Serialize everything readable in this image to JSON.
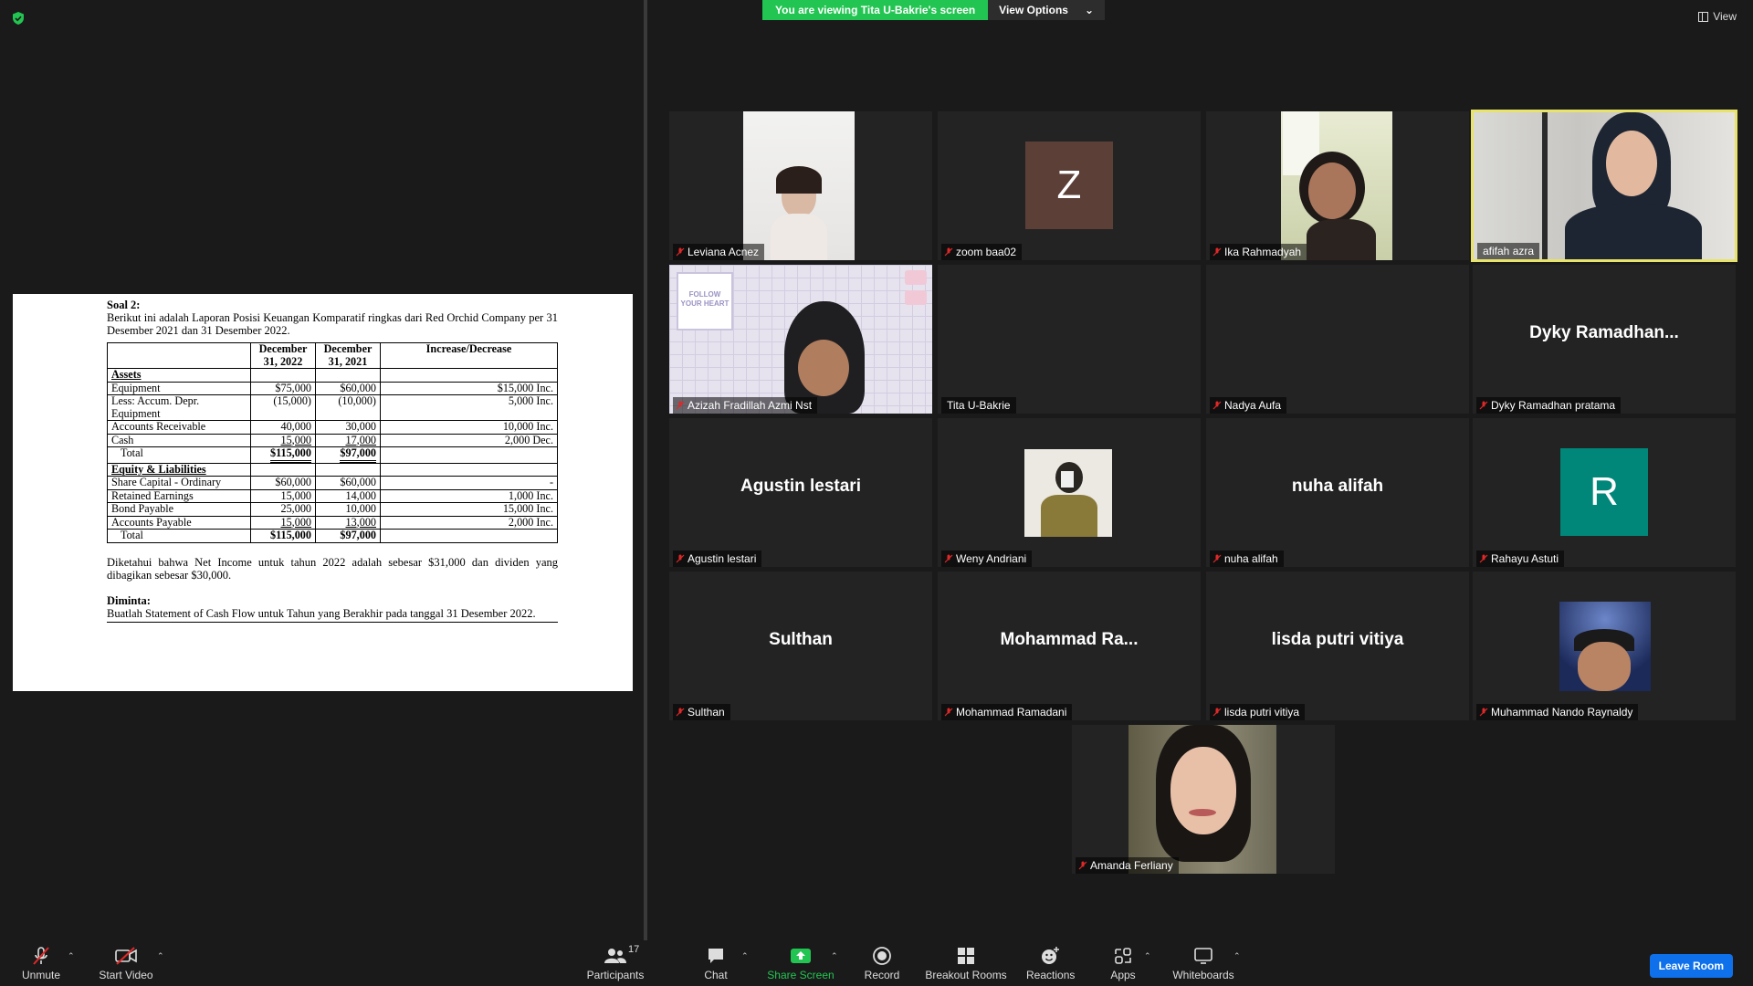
{
  "banner": {
    "viewing": "You are viewing Tita U-Bakrie's screen",
    "view_options": "View Options"
  },
  "view_label": "View",
  "doc": {
    "question": "Soal 2:",
    "intro": "Berikut ini adalah Laporan Posisi Keuangan Komparatif ringkas dari Red Orchid Company per 31 Desember 2021 dan 31 Desember 2022.",
    "headers": [
      "December 31, 2022",
      "December 31, 2021",
      "Increase/Decrease"
    ],
    "assets_heading": "Assets",
    "assets": [
      [
        "Equipment",
        "$75,000",
        "$60,000",
        "$15,000 Inc."
      ],
      [
        "Less: Accum. Depr. Equipment",
        "(15,000)",
        "(10,000)",
        "5,000 Inc."
      ],
      [
        "Accounts Receivable",
        "40,000",
        "30,000",
        "10,000 Inc."
      ],
      [
        "Cash",
        "15,000",
        "17,000",
        "2,000 Dec."
      ]
    ],
    "assets_total": [
      "Total",
      "$115,000",
      "$97,000",
      ""
    ],
    "eq_heading": "Equity & Liabilities",
    "equity": [
      [
        "Share Capital - Ordinary",
        "$60,000",
        "$60,000",
        "-"
      ],
      [
        "Retained Earnings",
        "15,000",
        "14,000",
        "1,000 Inc."
      ],
      [
        "Bond Payable",
        "25,000",
        "10,000",
        "15,000 Inc."
      ],
      [
        "Accounts Payable",
        "15,000",
        "13,000",
        "2,000 Inc."
      ]
    ],
    "eq_total": [
      "Total",
      "$115,000",
      "$97,000",
      ""
    ],
    "note": "Diketahui bahwa Net Income untuk tahun 2022 adalah sebesar $31,000 dan dividen yang dibagikan sebesar $30,000.",
    "diminta_heading": "Diminta:",
    "diminta": "Buatlah Statement of Cash Flow untuk Tahun yang Berakhir pada tanggal 31 Desember 2022."
  },
  "participants": [
    {
      "name": "Leviana Acnez",
      "display": "",
      "kind": "photo"
    },
    {
      "name": "zoom baa02",
      "display": "Z",
      "kind": "avatar",
      "color": "#5c3f37"
    },
    {
      "name": "Ika Rahmadyah",
      "display": "",
      "kind": "photo"
    },
    {
      "name": "afifah azra",
      "display": "",
      "kind": "photo"
    },
    {
      "name": "Azizah Fradillah Azmi Nst",
      "display": "",
      "kind": "photo"
    },
    {
      "name": "Tita U-Bakrie",
      "display": "",
      "kind": "blank"
    },
    {
      "name": "Nadya Aufa",
      "display": "",
      "kind": "blank"
    },
    {
      "name": "Dyky Ramadhan pratama",
      "display": "Dyky  Ramadhan...",
      "kind": "name"
    },
    {
      "name": "Agustin lestari",
      "display": "Agustin lestari",
      "kind": "name"
    },
    {
      "name": "Weny Andriani",
      "display": "",
      "kind": "photo"
    },
    {
      "name": "nuha alifah",
      "display": "nuha alifah",
      "kind": "name"
    },
    {
      "name": "Rahayu Astuti",
      "display": "R",
      "kind": "avatar",
      "color": "#00877a"
    },
    {
      "name": "Sulthan",
      "display": "Sulthan",
      "kind": "name"
    },
    {
      "name": "Mohammad Ramadani",
      "display": "Mohammad  Ra...",
      "kind": "name"
    },
    {
      "name": "lisda putri vitiya",
      "display": "lisda putri vitiya",
      "kind": "name"
    },
    {
      "name": "Muhammad Nando Raynaldy",
      "display": "",
      "kind": "photo"
    },
    {
      "name": "Amanda Ferliany",
      "display": "",
      "kind": "photo"
    }
  ],
  "poster_text": "FOLLOW YOUR HEART",
  "toolbar": {
    "unmute": "Unmute",
    "start_video": "Start Video",
    "participants": "Participants",
    "participants_count": "17",
    "chat": "Chat",
    "share_screen": "Share Screen",
    "record": "Record",
    "breakout": "Breakout Rooms",
    "reactions": "Reactions",
    "apps": "Apps",
    "whiteboards": "Whiteboards",
    "leave": "Leave Room"
  },
  "colors": {
    "share_green": "#23c552",
    "leave_blue": "#0e71eb",
    "active_border": "#e8e36a"
  }
}
